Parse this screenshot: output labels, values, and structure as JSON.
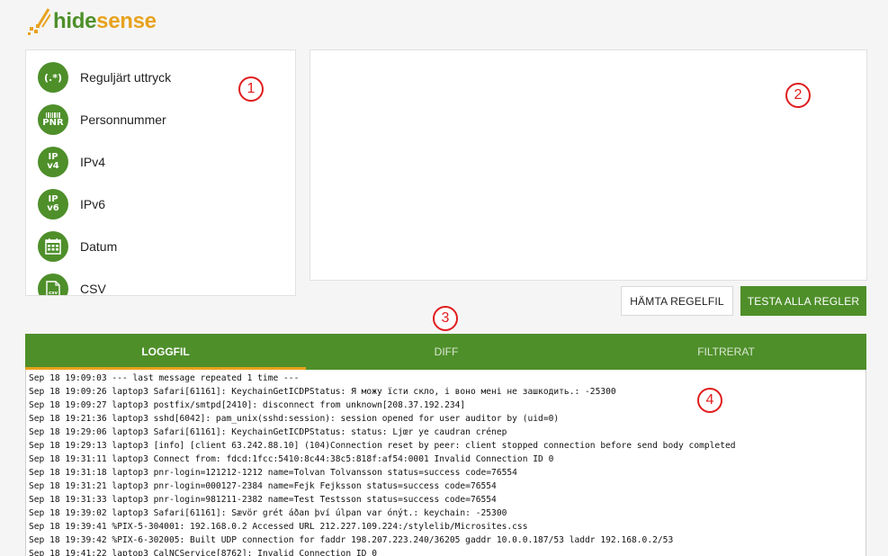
{
  "brand": {
    "name_part1": "hide",
    "name_part2": "sense"
  },
  "sidebar": {
    "items": [
      {
        "label": "Reguljärt uttryck",
        "icon": "regex-icon",
        "glyph": "(.*)"
      },
      {
        "label": "Personnummer",
        "icon": "pnr-icon",
        "glyph": "PNR"
      },
      {
        "label": "IPv4",
        "icon": "ipv4-icon",
        "glyph_top": "IP",
        "glyph_bottom": "v4"
      },
      {
        "label": "IPv6",
        "icon": "ipv6-icon",
        "glyph_top": "IP",
        "glyph_bottom": "v6"
      },
      {
        "label": "Datum",
        "icon": "calendar-icon"
      },
      {
        "label": "CSV",
        "icon": "csv-icon",
        "glyph": "csv"
      }
    ]
  },
  "buttons": {
    "fetch_label": "HÄMTA REGELFIL",
    "test_label": "TESTA ALLA REGLER"
  },
  "markers": [
    "1",
    "2",
    "3",
    "4"
  ],
  "tabs": [
    {
      "label": "LOGGFIL",
      "active": true
    },
    {
      "label": "DIFF",
      "active": false
    },
    {
      "label": "FILTRERAT",
      "active": false
    }
  ],
  "log": {
    "lines": [
      "Sep 18 19:09:03 --- last message repeated 1 time ---",
      "Sep 18 19:09:26 laptop3 Safari[61161]: KeychainGetICDPStatus: Я можу їсти скло, і воно мені не зашкодить.: -25300",
      "Sep 18 19:09:27 laptop3 postfix/smtpd[2410]: disconnect from unknown[208.37.192.234]",
      "Sep 18 19:21:36 laptop3 sshd[6042]: pam_unix(sshd:session): session opened for user auditor by (uid=0)",
      "Sep 18 19:29:06 laptop3 Safari[61161]: KeychainGetICDPStatus: status: Ljœr ye caudran crénep",
      "Sep 18 19:29:13 laptop3 [info] [client 63.242.88.10] (104)Connection reset by peer: client stopped connection before send body completed",
      "Sep 18 19:31:11 laptop3 Connect from: fdcd:1fcc:5410:8c44:38c5:818f:af54:0001 Invalid Connection ID 0",
      "Sep 18 19:31:18 laptop3 pnr-login=121212-1212 name=Tolvan Tolvansson status=success code=76554",
      "Sep 18 19:31:21 laptop3 pnr-login=000127-2384 name=Fejk Fejksson status=success code=76554",
      "Sep 18 19:31:33 laptop3 pnr-login=981211-2382 name=Test Testsson status=success code=76554",
      "Sep 18 19:39:02 laptop3 Safari[61161]: Sævör grét áðan því úlpan var ónýt.: keychain: -25300",
      "Sep 18 19:39:41 %PIX-5-304001: 192.168.0.2 Accessed URL 212.227.109.224:/stylelib/Microsites.css",
      "Sep 18 19:39:42 %PIX-6-302005: Built UDP connection for faddr 198.207.223.240/36205 gaddr 10.0.0.187/53 laddr 192.168.0.2/53",
      "Sep 18 19:41:22 laptop3 CalNCService[8762]: Invalid Connection ID 0"
    ]
  },
  "colors": {
    "brand_green": "#4e8f2a",
    "brand_orange": "#e8a21d",
    "marker_red": "#e01d1d"
  }
}
